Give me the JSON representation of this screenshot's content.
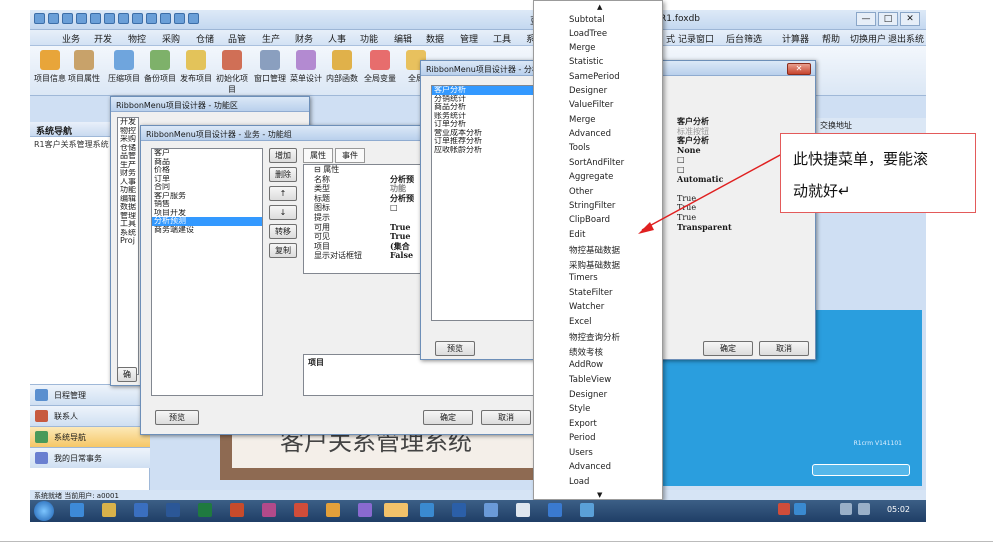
{
  "window": {
    "title_left": "豆",
    "title_right": "R1.foxdb",
    "controls": [
      "—",
      "□",
      "✕"
    ]
  },
  "menubar": {
    "items": [
      "业务",
      "开发",
      "物控",
      "采购",
      "仓储",
      "品管",
      "生产",
      "财务",
      "人事",
      "功能",
      "编辑",
      "数据",
      "管理",
      "工具",
      "系统"
    ],
    "right_items": [
      "式",
      "记录窗口",
      "后台筛选",
      "计算器",
      "帮助",
      "切换用户",
      "退出系统"
    ]
  },
  "ribbon": {
    "buttons": [
      "项目信息",
      "项目属性",
      "压缩项目",
      "备份项目",
      "发布项目",
      "初始化项目",
      "窗口管理",
      "菜单设计",
      "内部函数",
      "全局变量",
      "全局"
    ]
  },
  "leftnav": {
    "header": "系统导航",
    "subheader": "R1客户关系管理系统",
    "bottom_items": [
      "日程管理",
      "联系人",
      "系统导航",
      "我的日常事务"
    ]
  },
  "status": "系统就绪  当前用户: a0001",
  "right_strip": "交换地址",
  "dialog_functional": {
    "title": "RibbonMenu项目设计器 - 功能区",
    "items": [
      "开发",
      "物控",
      "采购",
      "仓储",
      "品管",
      "生产",
      "财务",
      "人事",
      "功能",
      "编辑",
      "数据",
      "管理",
      "工具",
      "系统",
      "Proj"
    ],
    "button": "确"
  },
  "dialog_group": {
    "title": "RibbonMenu项目设计器 - 业务 - 功能组",
    "items": [
      "客户",
      "商品",
      "价格",
      "订单",
      "合同",
      "客户服务",
      "销售",
      "项目开发",
      "分析预测",
      "商务端建设"
    ],
    "selected_index": 8,
    "side_buttons": [
      "增加",
      "删除",
      "↑",
      "↓",
      "转移",
      "复制"
    ],
    "tabs": [
      "属性",
      "事件"
    ],
    "property_rows": [
      {
        "key": "⊟ 属性",
        "value": ""
      },
      {
        "key": "名称",
        "value": "分析预"
      },
      {
        "key": "类型",
        "value": "功能"
      },
      {
        "key": "标题",
        "value": "分析预"
      },
      {
        "key": "图标",
        "value": "□"
      },
      {
        "key": "提示",
        "value": ""
      },
      {
        "key": "可用",
        "value": "True"
      },
      {
        "key": "可见",
        "value": "True"
      },
      {
        "key": "项目",
        "value": "(集合"
      },
      {
        "key": "显示对话框钮",
        "value": "False"
      }
    ],
    "desc_label": "项目",
    "preview": "预览",
    "ok": "确定",
    "cancel": "取消"
  },
  "dialog_analysis": {
    "title": "RibbonMenu项目设计器 - 分析预",
    "items": [
      "客户分析",
      "分销统计",
      "商品分析",
      "账务统计",
      "订单分析",
      "营业成本分析",
      "订单推荐分析",
      "应收帐龄分析"
    ],
    "selected_index": 0,
    "right_values": [
      "客户分析",
      "标准按钮",
      "客户分析",
      "None",
      "□",
      "□",
      "Automatic",
      "",
      "True",
      "True",
      "True",
      "Transparent"
    ],
    "preview": "预览",
    "ok": "确定",
    "cancel": "取消"
  },
  "popup_menu": {
    "items": [
      "Subtotal",
      "LoadTree",
      "Merge",
      "Statistic",
      "SamePeriod",
      "Designer",
      "ValueFilter",
      "Merge",
      "Advanced",
      "Tools",
      "SortAndFilter",
      "Aggregate",
      "Other",
      "StringFilter",
      "ClipBoard",
      "Edit",
      "物控基础数据",
      "采购基础数据",
      "Timers",
      "StateFilter",
      "Watcher",
      "Excel",
      "物控查询分析",
      "绩效考核",
      "AddRow",
      "TableView",
      "Designer",
      "Style",
      "Export",
      "Period",
      "Users",
      "Advanced",
      "Load"
    ]
  },
  "background": {
    "banner": "客户关系管理系统",
    "version": "R1crm V141101"
  },
  "annotation": {
    "line1": "此快捷菜单，要能滚",
    "line2": "动就好↵",
    "color": "#e02020"
  },
  "taskbar": {
    "clock": "05:02"
  }
}
